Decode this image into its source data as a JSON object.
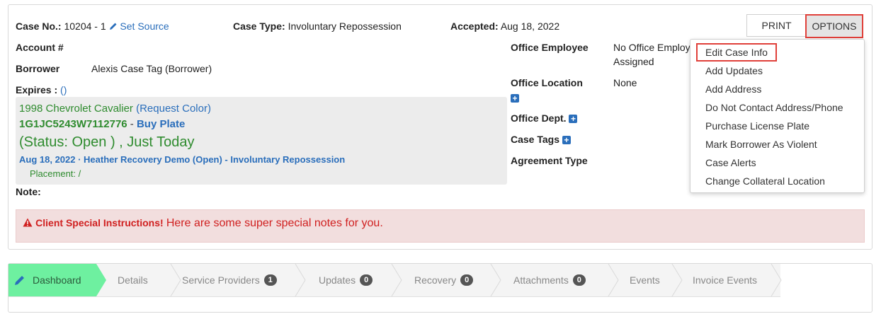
{
  "header": {
    "case_no_label": "Case No.:",
    "case_no_value": "10204 - 1",
    "set_source": "Set Source",
    "case_type_label": "Case Type:",
    "case_type_value": "Involuntary Repossession",
    "accepted_label": "Accepted:",
    "accepted_value": "Aug 18, 2022"
  },
  "left": {
    "account_label": "Account #",
    "borrower_label": "Borrower",
    "borrower_value": "Alexis Case Tag (Borrower)",
    "expires_label": "Expires :",
    "expires_value": "()",
    "note_label": "Note:"
  },
  "vehicle": {
    "title": "1998 Chevrolet Cavalier",
    "request_color": "(Request Color)",
    "vin": "1G1JC5243W7112776",
    "sep": " - ",
    "buy_plate": "Buy Plate",
    "status": "(Status: Open ) , Just Today",
    "order_line": "Aug 18, 2022 · Heather Recovery Demo (Open) - Involuntary Repossession",
    "placement": "Placement: /"
  },
  "right": {
    "office_employee_label": "Office Employee",
    "office_employee_value": "No Office Employ",
    "office_employee_value2": "Assigned",
    "office_location_label": "Office Location",
    "office_location_value": "None",
    "office_dept_label": "Office Dept.",
    "case_tags_label": "Case Tags",
    "agreement_type_label": "Agreement Type"
  },
  "special": {
    "label": "Client Special Instructions!",
    "text": "Here are some super special notes for you."
  },
  "toolbar": {
    "print_label": "PRINT",
    "options_label": "OPTIONS"
  },
  "options_menu": [
    "Edit Case Info",
    "Add Updates",
    "Add Address",
    "Do Not Contact Address/Phone",
    "Purchase License Plate",
    "Mark Borrower As Violent",
    "Case Alerts",
    "Change Collateral Location"
  ],
  "tabs": [
    {
      "label": "Dashboard"
    },
    {
      "label": "Details"
    },
    {
      "label": "Service Providers",
      "count": "1"
    },
    {
      "label": "Updates",
      "count": "0"
    },
    {
      "label": "Recovery",
      "count": "0"
    },
    {
      "label": "Attachments",
      "count": "0"
    },
    {
      "label": "Events"
    },
    {
      "label": "Invoice Events"
    }
  ],
  "colors": {
    "link": "#2a6ebb",
    "green": "#2e8b2e",
    "active_tab": "#6ef0a0",
    "alert_red": "#d02020",
    "highlight_border": "#e0403a"
  }
}
